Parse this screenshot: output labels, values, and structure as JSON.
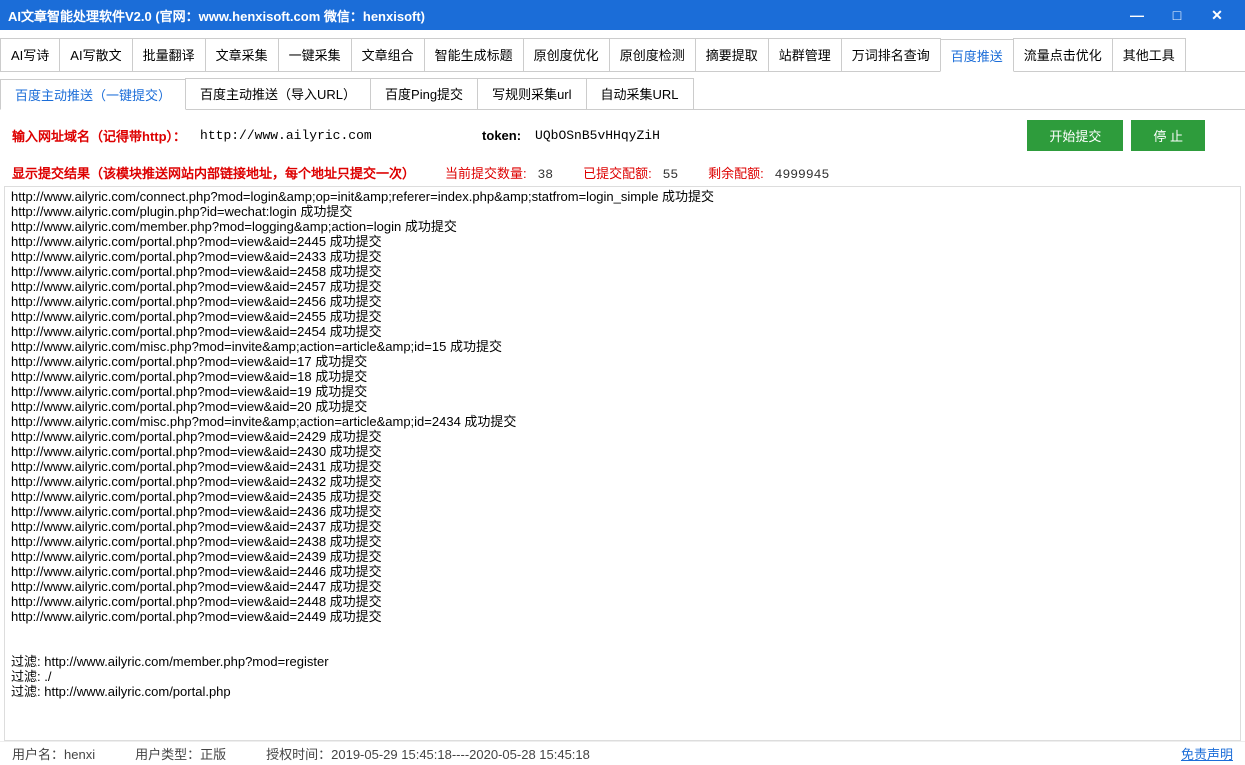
{
  "title": "AI文章智能处理软件V2.0 (官网：www.henxisoft.com  微信：henxisoft)",
  "mainTabs": [
    "AI写诗",
    "AI写散文",
    "批量翻译",
    "文章采集",
    "一键采集",
    "文章组合",
    "智能生成标题",
    "原创度优化",
    "原创度检测",
    "摘要提取",
    "站群管理",
    "万词排名查询",
    "百度推送",
    "流量点击优化",
    "其他工具"
  ],
  "mainActive": 12,
  "subTabs": [
    "百度主动推送（一键提交）",
    "百度主动推送（导入URL）",
    "百度Ping提交",
    "写规则采集url",
    "自动采集URL"
  ],
  "subActive": 0,
  "form": {
    "urlLabel": "输入网址域名（记得带http）：",
    "urlValue": "http://www.ailyric.com",
    "tokenLabel": "token:",
    "tokenValue": "UQbOSnB5vHHqyZiH",
    "startBtn": "开始提交",
    "stopBtn": "停 止"
  },
  "resultHeader": {
    "title": "显示提交结果（该模块推送网站内部链接地址，每个地址只提交一次）",
    "curLabel": "当前提交数量:",
    "curVal": "38",
    "doneLabel": "已提交配额:",
    "doneVal": "55",
    "remainLabel": "剩余配额:",
    "remainVal": "4999945"
  },
  "logLines": [
    "http://www.ailyric.com/connect.php?mod=login&amp;op=init&amp;referer=index.php&amp;statfrom=login_simple   成功提交",
    "http://www.ailyric.com/plugin.php?id=wechat:login   成功提交",
    "http://www.ailyric.com/member.php?mod=logging&amp;action=login   成功提交",
    "http://www.ailyric.com/portal.php?mod=view&aid=2445   成功提交",
    "http://www.ailyric.com/portal.php?mod=view&aid=2433   成功提交",
    "http://www.ailyric.com/portal.php?mod=view&aid=2458   成功提交",
    "http://www.ailyric.com/portal.php?mod=view&aid=2457   成功提交",
    "http://www.ailyric.com/portal.php?mod=view&aid=2456   成功提交",
    "http://www.ailyric.com/portal.php?mod=view&aid=2455   成功提交",
    "http://www.ailyric.com/portal.php?mod=view&aid=2454   成功提交",
    "http://www.ailyric.com/misc.php?mod=invite&amp;action=article&amp;id=15   成功提交",
    "http://www.ailyric.com/portal.php?mod=view&aid=17   成功提交",
    "http://www.ailyric.com/portal.php?mod=view&aid=18   成功提交",
    "http://www.ailyric.com/portal.php?mod=view&aid=19   成功提交",
    "http://www.ailyric.com/portal.php?mod=view&aid=20   成功提交",
    "http://www.ailyric.com/misc.php?mod=invite&amp;action=article&amp;id=2434   成功提交",
    "http://www.ailyric.com/portal.php?mod=view&aid=2429   成功提交",
    "http://www.ailyric.com/portal.php?mod=view&aid=2430   成功提交",
    "http://www.ailyric.com/portal.php?mod=view&aid=2431   成功提交",
    "http://www.ailyric.com/portal.php?mod=view&aid=2432   成功提交",
    "http://www.ailyric.com/portal.php?mod=view&aid=2435   成功提交",
    "http://www.ailyric.com/portal.php?mod=view&aid=2436   成功提交",
    "http://www.ailyric.com/portal.php?mod=view&aid=2437   成功提交",
    "http://www.ailyric.com/portal.php?mod=view&aid=2438   成功提交",
    "http://www.ailyric.com/portal.php?mod=view&aid=2439   成功提交",
    "http://www.ailyric.com/portal.php?mod=view&aid=2446   成功提交",
    "http://www.ailyric.com/portal.php?mod=view&aid=2447   成功提交",
    "http://www.ailyric.com/portal.php?mod=view&aid=2448   成功提交",
    "http://www.ailyric.com/portal.php?mod=view&aid=2449   成功提交",
    "",
    "",
    "过滤: http://www.ailyric.com/member.php?mod=register",
    "过滤: ./",
    "过滤: http://www.ailyric.com/portal.php"
  ],
  "status": {
    "userLabel": "用户名：",
    "user": "henxi",
    "typeLabel": "用户类型：",
    "type": "正版",
    "authLabel": "授权时间：",
    "auth": "2019-05-29 15:45:18----2020-05-28 15:45:18",
    "disclaimer": "免责声明"
  }
}
